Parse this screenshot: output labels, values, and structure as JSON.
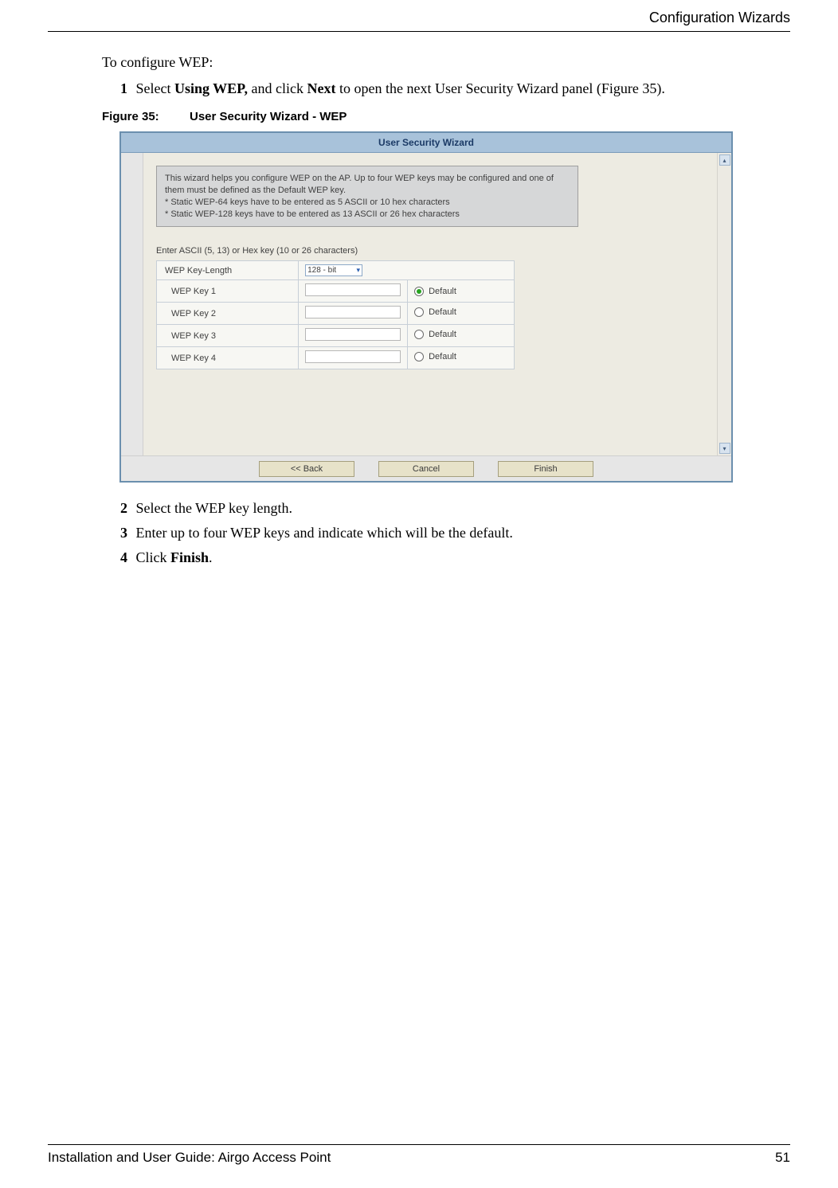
{
  "header": {
    "section": "Configuration Wizards"
  },
  "intro": "To configure WEP:",
  "steps": {
    "s1_num": "1",
    "s1a": "Select ",
    "s1b": "Using WEP,",
    "s1c": " and click ",
    "s1d": "Next",
    "s1e": " to open the next User Security Wizard panel (Figure 35).",
    "s2_num": "2",
    "s2": "Select the WEP key length.",
    "s3_num": "3",
    "s3": "Enter up to four WEP keys and indicate which will be the default.",
    "s4_num": "4",
    "s4a": "Click ",
    "s4b": "Finish",
    "s4c": "."
  },
  "figure": {
    "label": "Figure 35:",
    "title": "User Security Wizard - WEP"
  },
  "wizard": {
    "title": "User Security Wizard",
    "help_line1": "This wizard helps you configure WEP on the AP. Up to four WEP keys may be configured and one of them must be defined as the Default WEP key.",
    "help_line2": "* Static WEP-64 keys have to be entered as 5 ASCII or 10 hex characters",
    "help_line3": "* Static WEP-128 keys have to be entered as 13 ASCII or 26 hex characters",
    "prompt": "Enter ASCII (5, 13) or Hex key (10 or 26 characters)",
    "key_length_label": "WEP Key-Length",
    "key_length_value": "128 - bit",
    "rows": [
      {
        "label": "WEP Key 1",
        "default_label": "Default",
        "selected": true
      },
      {
        "label": "WEP Key 2",
        "default_label": "Default",
        "selected": false
      },
      {
        "label": "WEP Key 3",
        "default_label": "Default",
        "selected": false
      },
      {
        "label": "WEP Key 4",
        "default_label": "Default",
        "selected": false
      }
    ],
    "back": "<< Back",
    "cancel": "Cancel",
    "finish": "Finish"
  },
  "footer": {
    "doc": "Installation and User Guide: Airgo Access Point",
    "page": "51"
  }
}
